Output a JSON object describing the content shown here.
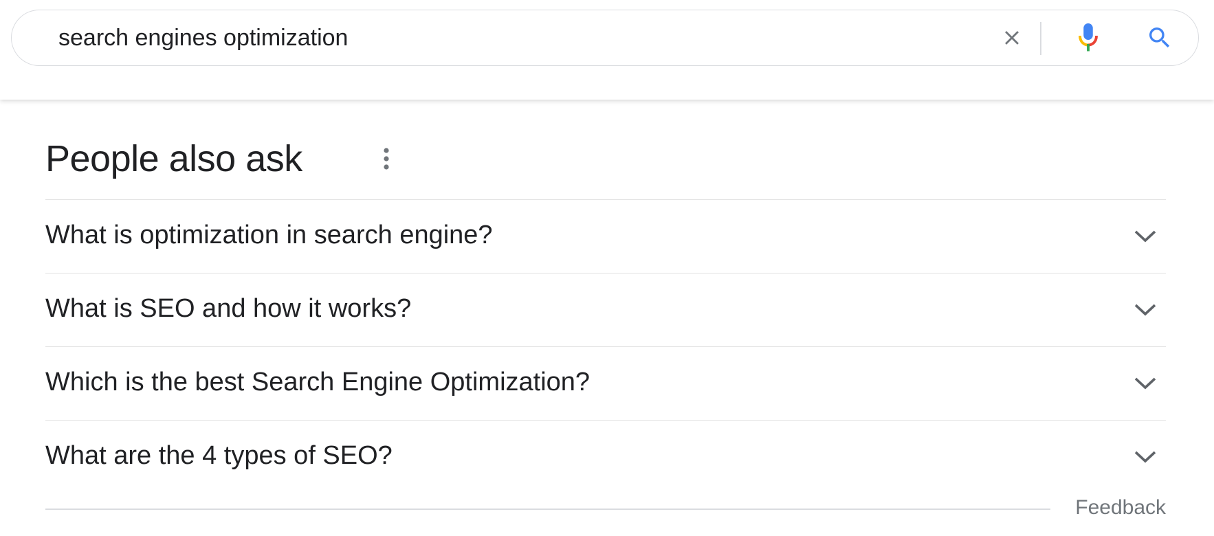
{
  "search": {
    "query": "search engines optimization",
    "clear_icon": "close-icon",
    "mic_icon": "microphone-icon",
    "search_icon": "search-icon",
    "colors": {
      "search_blue": "#4285f4",
      "mic_red": "#ea4335",
      "mic_yellow": "#fbbc04",
      "mic_green": "#34a853",
      "clear_gray": "#70757a"
    }
  },
  "people_also_ask": {
    "title": "People also ask",
    "more_icon": "more-vert-icon",
    "questions": [
      {
        "text": "What is optimization in search engine?",
        "icon": "chevron-down-icon"
      },
      {
        "text": "What is SEO and how it works?",
        "icon": "chevron-down-icon"
      },
      {
        "text": "Which is the best Search Engine Optimization?",
        "icon": "chevron-down-icon"
      },
      {
        "text": "What are the 4 types of SEO?",
        "icon": "chevron-down-icon"
      }
    ],
    "feedback_label": "Feedback"
  }
}
